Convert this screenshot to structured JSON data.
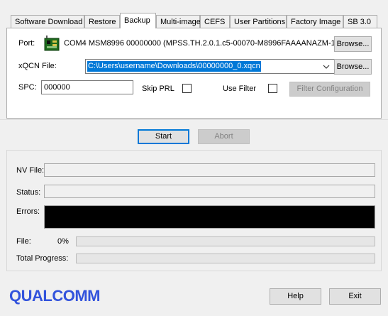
{
  "tabs": [
    {
      "label": "Software Download",
      "active": false
    },
    {
      "label": "Restore",
      "active": false
    },
    {
      "label": "Backup",
      "active": true
    },
    {
      "label": "Multi-image",
      "active": false
    },
    {
      "label": "CEFS",
      "active": false
    },
    {
      "label": "User Partitions",
      "active": false
    },
    {
      "label": "Factory Image",
      "active": false
    },
    {
      "label": "SB 3.0",
      "active": false
    }
  ],
  "backup": {
    "port_label": "Port:",
    "port_value": "COM4  MSM8996  00000000  (MPSS.TH.2.0.1.c5-00070-M8996FAAAANAZM-1",
    "port_browse": "Browse...",
    "xqcn_label": "xQCN File:",
    "xqcn_value": "C:\\Users\\username\\Downloads\\00000000_0.xqcn",
    "xqcn_browse": "Browse...",
    "spc_label": "SPC:",
    "spc_value": "000000",
    "skip_prl_label": "Skip PRL",
    "skip_prl_checked": false,
    "use_filter_label": "Use Filter",
    "use_filter_checked": false,
    "filter_config_label": "Filter Configuration"
  },
  "actions": {
    "start_label": "Start",
    "abort_label": "Abort"
  },
  "status": {
    "nv_file_label": "NV File:",
    "nv_file_value": "",
    "status_label": "Status:",
    "status_value": "",
    "errors_label": "Errors:",
    "errors_value": "",
    "file_label": "File:",
    "file_percent": "0%",
    "file_progress": 0,
    "total_label": "Total Progress:",
    "total_progress": 0
  },
  "footer": {
    "logo_text": "QUALCOMM",
    "help_label": "Help",
    "exit_label": "Exit"
  },
  "colors": {
    "selection": "#0078d7",
    "logo": "#3253dc",
    "progress_fill": "#06b025"
  },
  "icons": {
    "port": "usb-device-icon",
    "dropdown": "chevron-down-icon"
  }
}
